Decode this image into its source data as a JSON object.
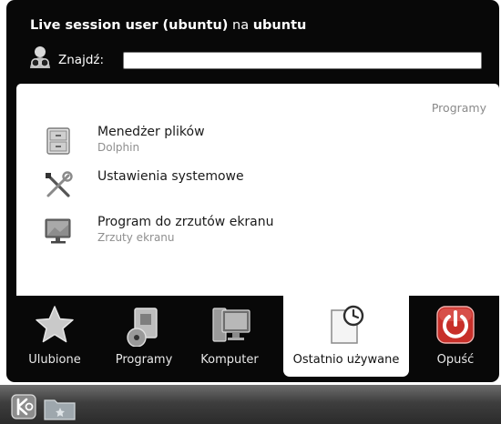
{
  "header": {
    "user_name": "Live session user (ubuntu)",
    "connector": "na",
    "host_name": "ubuntu"
  },
  "search": {
    "label": "Znajdź:",
    "value": "",
    "placeholder": ""
  },
  "section": {
    "heading": "Programy"
  },
  "results": [
    {
      "title": "Menedżer plików",
      "subtitle": "Dolphin",
      "icon": "file-manager-icon"
    },
    {
      "title": "Ustawienia systemowe",
      "subtitle": "",
      "icon": "system-settings-icon"
    },
    {
      "title": "Program do zrzutów ekranu",
      "subtitle": "Zrzuty ekranu",
      "icon": "screenshot-icon"
    }
  ],
  "tabs": [
    {
      "label": "Ulubione",
      "icon": "star-icon",
      "active": false
    },
    {
      "label": "Programy",
      "icon": "applications-icon",
      "active": false
    },
    {
      "label": "Komputer",
      "icon": "computer-icon",
      "active": false
    },
    {
      "label": "Ostatnio używane",
      "icon": "recent-document-icon",
      "active": true
    },
    {
      "label": "Opuść",
      "icon": "power-icon",
      "active": false
    }
  ],
  "taskbar": {
    "buttons": [
      "kde-launcher-icon",
      "folder-icon"
    ]
  },
  "colors": {
    "menu_background": "#080808",
    "panel_background": "#ffffff",
    "power_red": "#c8302a",
    "star_color": "#c9c9c9"
  }
}
